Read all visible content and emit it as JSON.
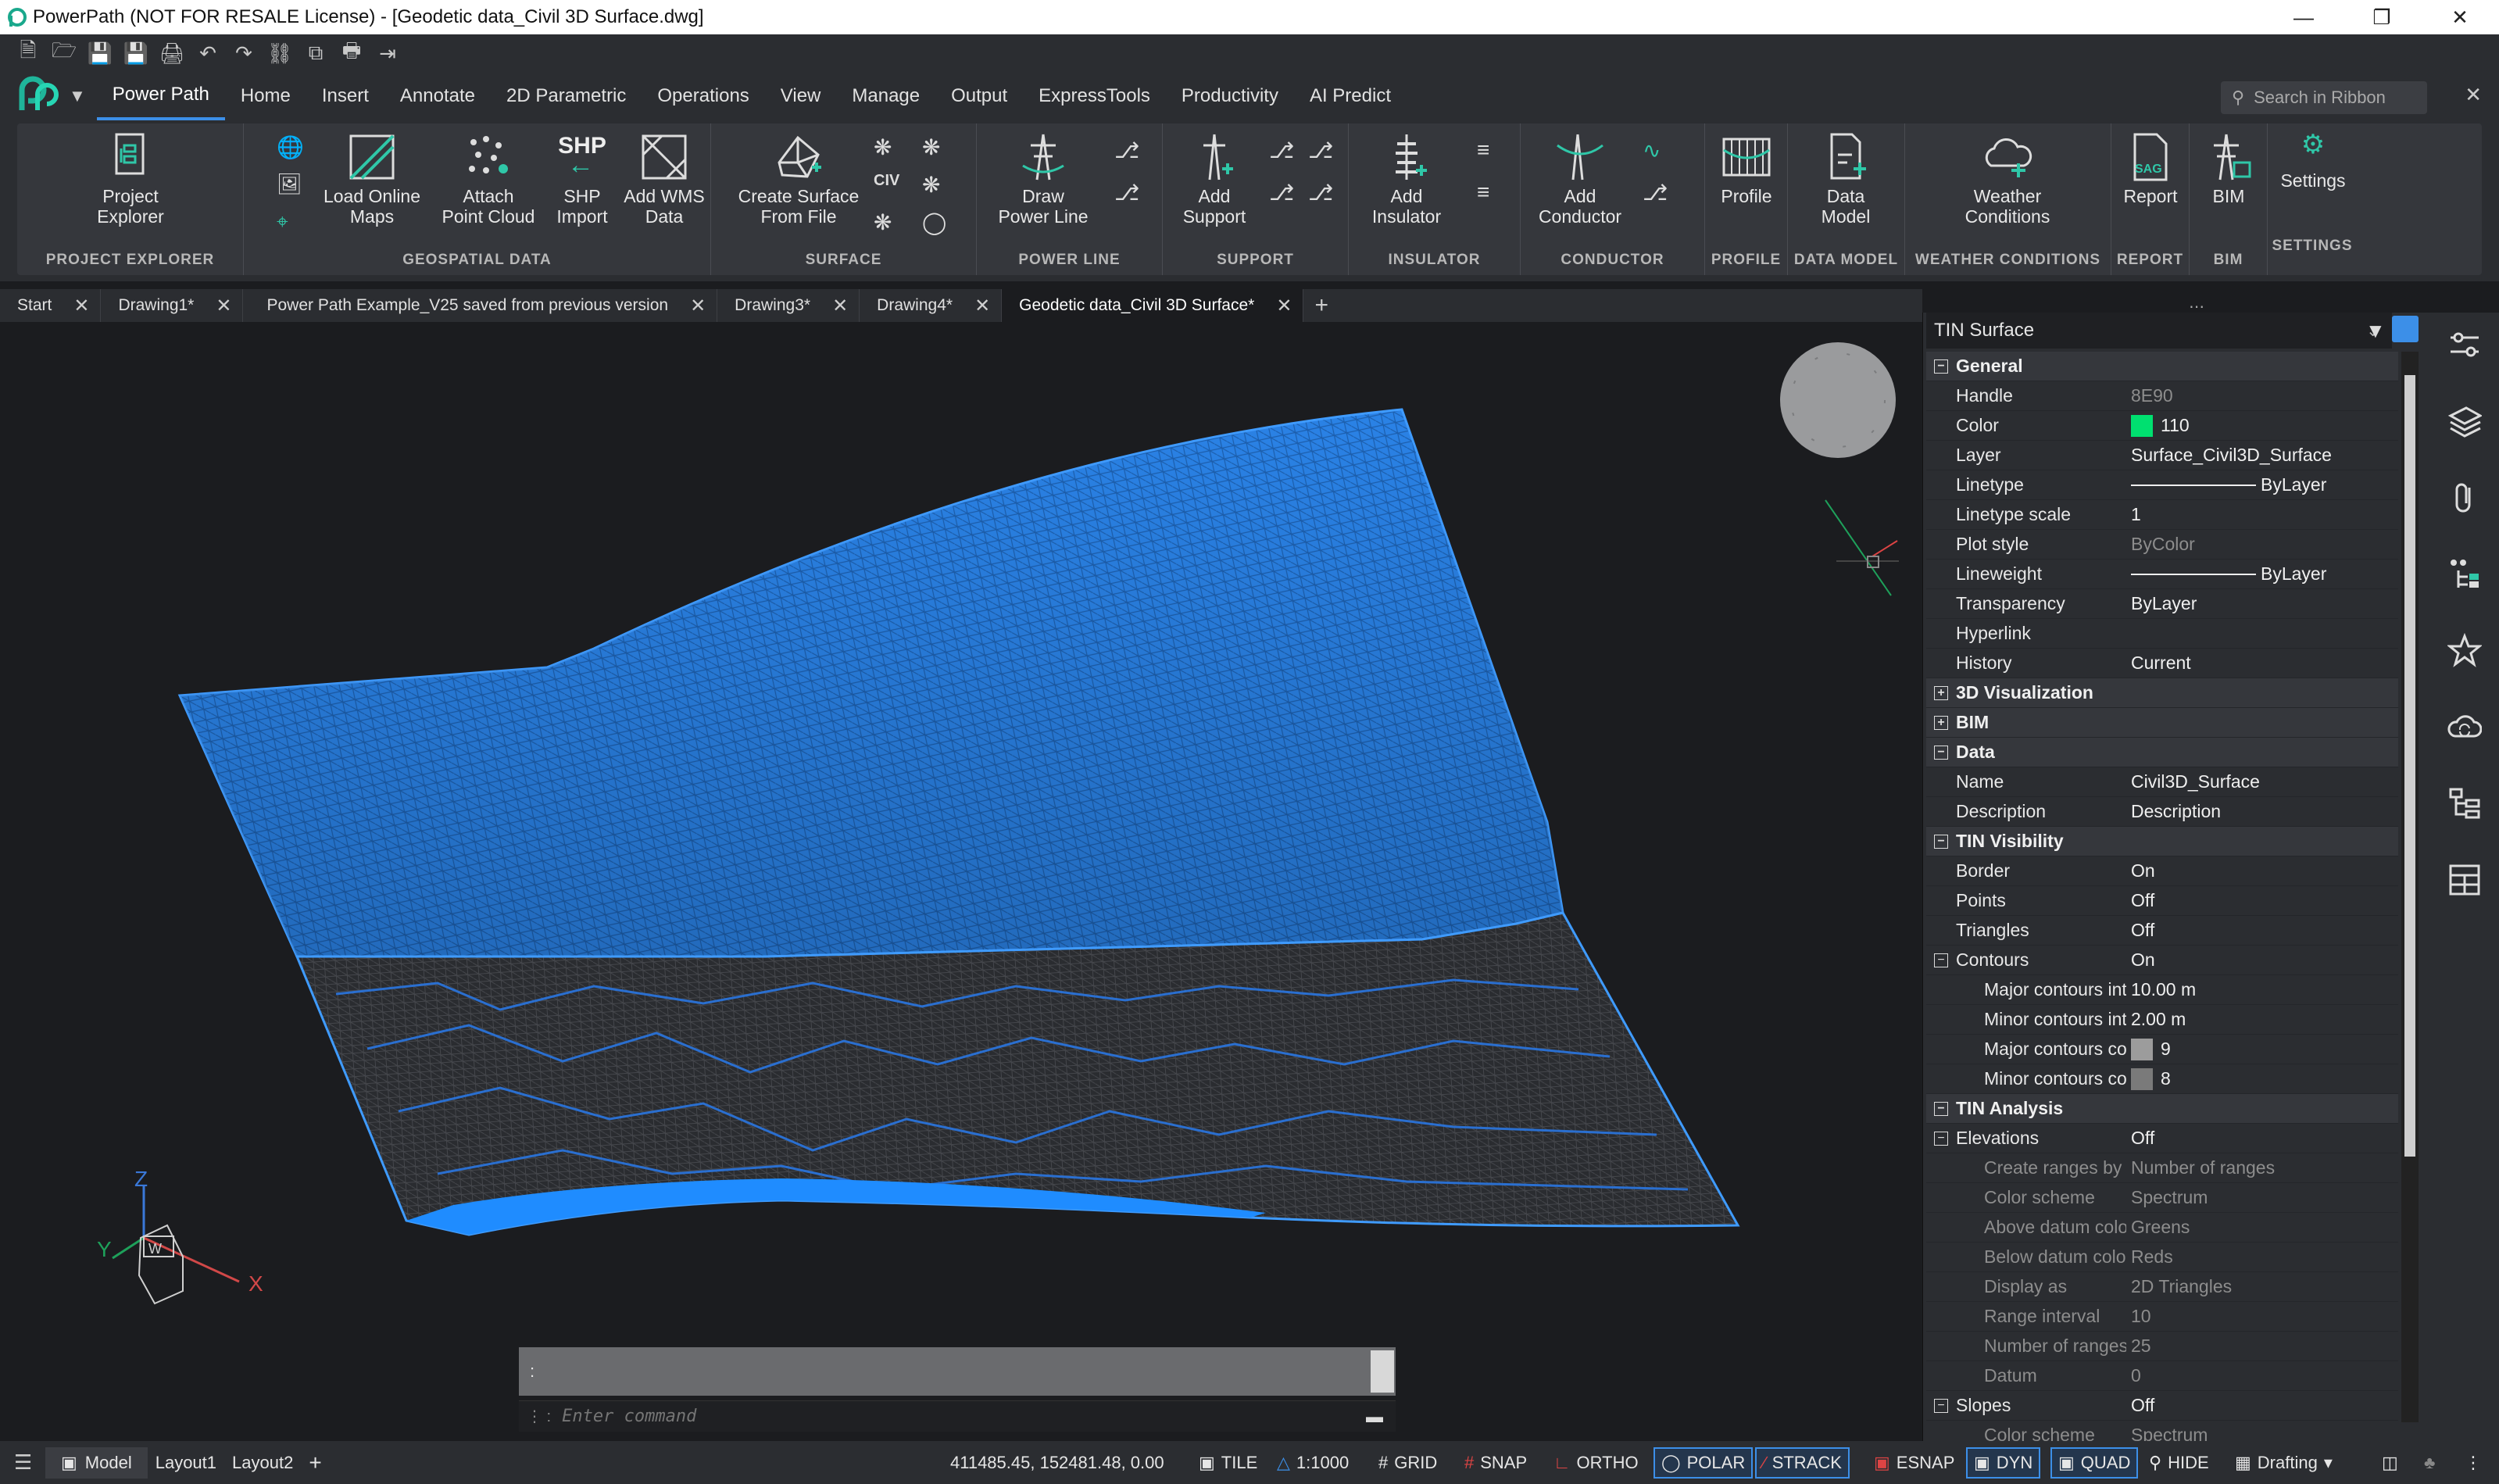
{
  "window": {
    "title": "PowerPath (NOT FOR RESALE License) - [Geodetic data_Civil 3D Surface.dwg]"
  },
  "ribbon": {
    "tabs": [
      "Power Path",
      "Home",
      "Insert",
      "Annotate",
      "2D Parametric",
      "Operations",
      "View",
      "Manage",
      "Output",
      "ExpressTools",
      "Productivity",
      "AI Predict"
    ],
    "active_tab": "Power Path",
    "search_placeholder": "Search in Ribbon",
    "groups": {
      "project_explorer": {
        "title": "PROJECT EXPLORER",
        "btn": "Project\nExplorer"
      },
      "geospatial": {
        "title": "GEOSPATIAL DATA",
        "load": "Load Online\nMaps",
        "attach": "Attach\nPoint Cloud",
        "shp": "SHP\nImport",
        "wms": "Add WMS\nData",
        "shp_badge": "SHP"
      },
      "surface": {
        "title": "SURFACE",
        "create": "Create Surface\nFrom File"
      },
      "power_line": {
        "title": "POWER LINE",
        "draw": "Draw\nPower Line"
      },
      "support": {
        "title": "SUPPORT",
        "add": "Add\nSupport"
      },
      "insulator": {
        "title": "INSULATOR",
        "add": "Add\nInsulator"
      },
      "conductor": {
        "title": "CONDUCTOR",
        "add": "Add\nConductor"
      },
      "profile": {
        "title": "PROFILE",
        "btn": "Profile"
      },
      "data_model": {
        "title": "DATA MODEL",
        "btn": "Data\nModel"
      },
      "weather": {
        "title": "WEATHER CONDITIONS",
        "btn": "Weather\nConditions"
      },
      "report": {
        "title": "REPORT",
        "btn": "Report",
        "badge": "SAG"
      },
      "bim": {
        "title": "BIM",
        "btn": "BIM"
      },
      "settings": {
        "title": "SETTINGS",
        "btn": "Settings"
      }
    }
  },
  "doc_tabs": [
    {
      "label": "Start",
      "active": false
    },
    {
      "label": "Drawing1*",
      "active": false
    },
    {
      "label": "Power Path Example_V25 saved from previous version",
      "active": false
    },
    {
      "label": "Drawing3*",
      "active": false
    },
    {
      "label": "Drawing4*",
      "active": false
    },
    {
      "label": "Geodetic data_Civil 3D Surface*",
      "active": true
    }
  ],
  "viewport": {
    "axis_x": "X",
    "axis_y": "Y",
    "axis_z": "Z",
    "ucs_label": "W"
  },
  "command": {
    "history": ":",
    "placeholder": "Enter command"
  },
  "properties": {
    "selection": "TIN Surface",
    "colors": {
      "color_110": "#00e070",
      "major_contour": "#9c9c9c",
      "minor_contour": "#7a7a7a"
    },
    "rows": [
      {
        "type": "cat",
        "label": "General",
        "open": true
      },
      {
        "k": "Handle",
        "v": "8E90",
        "dim_v": true
      },
      {
        "k": "Color",
        "v": "110",
        "swatch": "color_110"
      },
      {
        "k": "Layer",
        "v": "Surface_Civil3D_Surface"
      },
      {
        "k": "Linetype",
        "v": "ByLayer",
        "line": true
      },
      {
        "k": "Linetype scale",
        "v": "1"
      },
      {
        "k": "Plot style",
        "v": "ByColor",
        "dim_v": true
      },
      {
        "k": "Lineweight",
        "v": "ByLayer",
        "line": true
      },
      {
        "k": "Transparency",
        "v": "ByLayer"
      },
      {
        "k": "Hyperlink",
        "v": ""
      },
      {
        "k": "History",
        "v": "Current"
      },
      {
        "type": "cat",
        "label": "3D Visualization",
        "open": false
      },
      {
        "type": "cat",
        "label": "BIM",
        "open": false
      },
      {
        "type": "cat",
        "label": "Data",
        "open": true
      },
      {
        "k": "Name",
        "v": "Civil3D_Surface"
      },
      {
        "k": "Description",
        "v": "Description"
      },
      {
        "type": "cat",
        "label": "TIN Visibility",
        "open": true
      },
      {
        "k": "Border",
        "v": "On"
      },
      {
        "k": "Points",
        "v": "Off"
      },
      {
        "k": "Triangles",
        "v": "Off"
      },
      {
        "type": "sub",
        "k": "Contours",
        "v": "On"
      },
      {
        "k": "Major contours inter",
        "v": "10.00 m",
        "indent": true
      },
      {
        "k": "Minor contours inter",
        "v": "2.00 m",
        "indent": true
      },
      {
        "k": "Major contours color",
        "v": "9",
        "indent": true,
        "swatch": "major_contour"
      },
      {
        "k": "Minor contours color",
        "v": "8",
        "indent": true,
        "swatch": "minor_contour"
      },
      {
        "type": "cat",
        "label": "TIN Analysis",
        "open": true
      },
      {
        "type": "sub",
        "k": "Elevations",
        "v": "Off"
      },
      {
        "k": "Create ranges by",
        "v": "Number of ranges",
        "indent": true,
        "dim": true
      },
      {
        "k": "Color scheme",
        "v": "Spectrum",
        "indent": true,
        "dim": true
      },
      {
        "k": "Above datum color s",
        "v": "Greens",
        "indent": true,
        "dim": true
      },
      {
        "k": "Below datum color s",
        "v": "Reds",
        "indent": true,
        "dim": true
      },
      {
        "k": "Display as",
        "v": "2D Triangles",
        "indent": true,
        "dim": true
      },
      {
        "k": "Range interval",
        "v": "10",
        "indent": true,
        "dim": true
      },
      {
        "k": "Number of ranges",
        "v": "25",
        "indent": true,
        "dim": true
      },
      {
        "k": "Datum",
        "v": "0",
        "indent": true,
        "dim": true
      },
      {
        "type": "sub",
        "k": "Slopes",
        "v": "Off"
      },
      {
        "k": "Color scheme",
        "v": "Spectrum",
        "indent": true,
        "dim": true
      }
    ]
  },
  "statusbar": {
    "layouts": [
      "Model",
      "Layout1",
      "Layout2"
    ],
    "coords": "411485.45, 152481.48, 0.00",
    "tile": "TILE",
    "scale": "1:1000",
    "grid": "GRID",
    "snap": "SNAP",
    "ortho": "ORTHO",
    "polar": "POLAR",
    "strack": "STRACK",
    "esnap": "ESNAP",
    "dyn": "DYN",
    "quad": "QUAD",
    "hide": "HIDE",
    "workspace": "Drafting"
  }
}
